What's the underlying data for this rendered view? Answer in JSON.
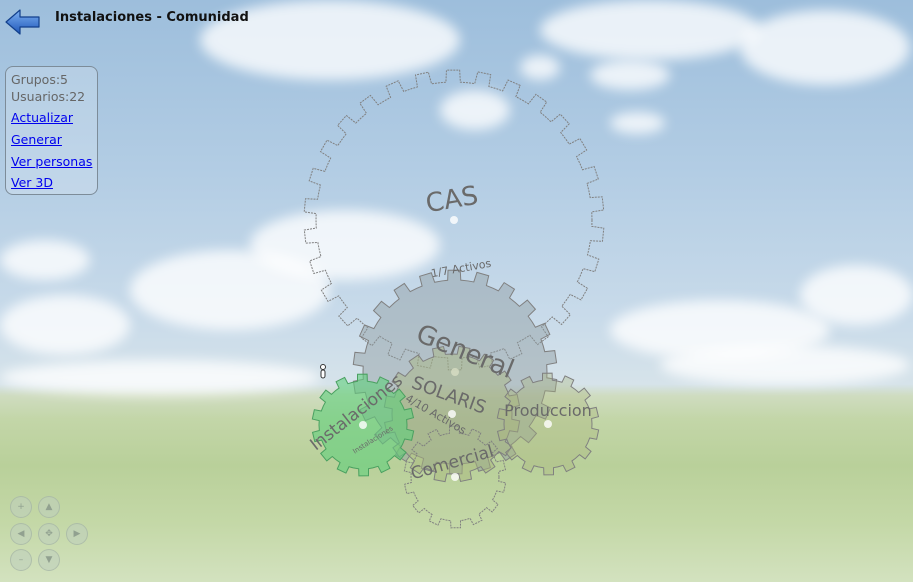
{
  "header": {
    "title": "Instalaciones - Comunidad"
  },
  "info_panel": {
    "stats": [
      {
        "label": "Grupos",
        "value": "5",
        "text": "Grupos:5"
      },
      {
        "label": "Usuarios",
        "value": "22",
        "text": "Usuarios:22"
      }
    ],
    "links": [
      {
        "label": "Actualizar"
      },
      {
        "label": "Generar"
      },
      {
        "label": "Ver personas"
      },
      {
        "label": "Ver 3D"
      }
    ]
  },
  "gears": [
    {
      "name": "CAS",
      "caption": "1/7 Activos"
    },
    {
      "name": "General",
      "caption": ""
    },
    {
      "name": "SOLARIS",
      "caption": "4/10 Activos"
    },
    {
      "name": "Produccion",
      "caption": ""
    },
    {
      "name": "Comercial",
      "caption": ""
    },
    {
      "name": "Instalaciones",
      "caption": "Instalaciones"
    }
  ],
  "nav_controls": {
    "buttons": [
      {
        "icon": "zoom-in-icon",
        "glyph": "+"
      },
      {
        "icon": "arrow-up-icon",
        "glyph": "▲"
      },
      {
        "icon": "arrow-left-icon",
        "glyph": "◀"
      },
      {
        "icon": "move-center-icon",
        "glyph": "✥"
      },
      {
        "icon": "arrow-right-icon",
        "glyph": "▶"
      },
      {
        "icon": "zoom-out-icon",
        "glyph": "–"
      },
      {
        "icon": "arrow-down-icon",
        "glyph": "▼"
      }
    ]
  },
  "colors": {
    "link": "#0000ee",
    "gear_outline": "#808080",
    "gear_fill_gray": "#8f9ba0",
    "gear_fill_olive": "#a9b57c",
    "gear_fill_selected": "#5fcf7c",
    "back_arrow": "#2f6fd1"
  }
}
